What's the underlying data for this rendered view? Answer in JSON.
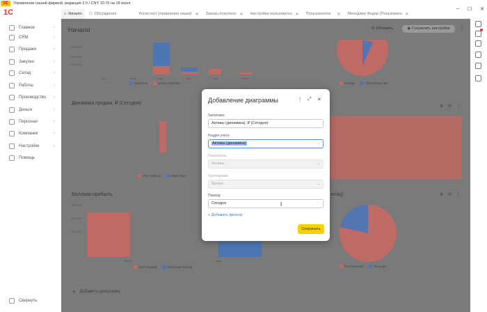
{
  "window": {
    "title": "Управление нашей фирмой, редакция 3.0 / CNY 10,76 на 18 июня"
  },
  "brand": {
    "logo": "1С"
  },
  "tabs": [
    {
      "label": "Начало",
      "active": true
    },
    {
      "label": "Обсуждения",
      "active": false
    },
    {
      "label": "Ассистент управления нашей фирмой",
      "active": false
    },
    {
      "label": "Заказы покупателей",
      "active": false
    },
    {
      "label": "Настройки пользователей и прав",
      "active": false
    },
    {
      "label": "Пользователи",
      "active": false
    },
    {
      "label": "Менеджер Федор (Пользователь)",
      "active": false
    }
  ],
  "sidebar": {
    "items": [
      {
        "label": "Главное"
      },
      {
        "label": "CRM"
      },
      {
        "label": "Продажи"
      },
      {
        "label": "Закупки"
      },
      {
        "label": "Склад"
      },
      {
        "label": "Работы"
      },
      {
        "label": "Производство"
      },
      {
        "label": "Деньги"
      },
      {
        "label": "Персонал"
      },
      {
        "label": "Компания"
      },
      {
        "label": "Настройки"
      },
      {
        "label": "Помощь"
      }
    ],
    "collapse_label": "Свернуть"
  },
  "main": {
    "title": "Начало",
    "refresh_label": "Обновить",
    "save_settings_label": "Сохранить настройки",
    "add_chart_label": "Добавить диаграмму"
  },
  "cards": {
    "top_left": {
      "y_ticks": [
        "3 000 000",
        "2 000 000",
        "1 000 000"
      ],
      "categories": [
        "янв",
        "февр",
        "март",
        "апр",
        "май",
        "июнь"
      ],
      "legend": [
        "Прибыль",
        "Себестоимость"
      ]
    },
    "top_right": {
      "legend": [
        "Активы",
        "Обязательства"
      ]
    },
    "sales": {
      "title": "Динамика продаж, ₽ (Сегодня)",
      "legend": [
        "Этот период",
        "Март 2024"
      ]
    },
    "gross": {
      "title": "Валовая прибыль",
      "y_ticks": [
        "300 000",
        "200 000",
        "100 000"
      ],
      "categories": [
        "январь",
        "март"
      ],
      "legend": [
        "Этот период",
        "Прошлый период"
      ]
    },
    "right_pie": {
      "title_tail": "есяц)",
      "legend": [
        "Поступления",
        "Расходы"
      ]
    }
  },
  "modal": {
    "title": "Добавление диаграммы",
    "fields": {
      "header": {
        "label": "Заголовок",
        "value": "Активы (динамика), ₽ (Сегодня)"
      },
      "section": {
        "label": "Раздел учета",
        "value": "Активы (динамика)"
      },
      "indicator": {
        "label": "Показатель",
        "value": "Активы"
      },
      "grouping": {
        "label": "Группировка",
        "value": "Время"
      },
      "period": {
        "label": "Период",
        "value": "Сегодня"
      }
    },
    "add_filter_label": "+ Добавить фильтр",
    "save_label": "Сохранить"
  },
  "colors": {
    "bar_red": "#c06a66",
    "bar_blue": "#4d77b4",
    "pie_red": "#c06a66",
    "pie_blue": "#5176b0",
    "accent_yellow": "#f8d000",
    "link_blue": "#3b7ddd"
  }
}
